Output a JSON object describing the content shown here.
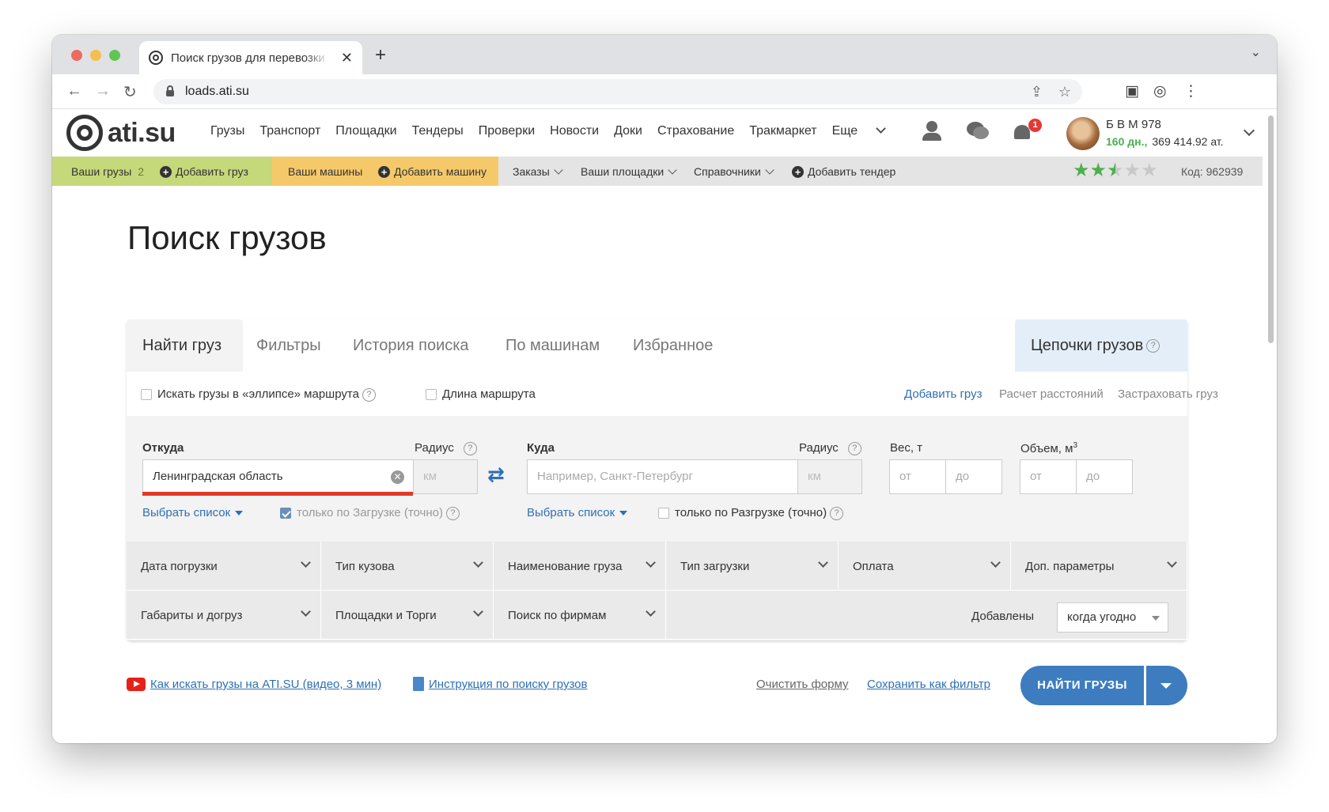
{
  "browser": {
    "tab_title": "Поиск грузов для перевозки",
    "tab_close": "✕",
    "new_tab": "+",
    "url": "loads.ati.su"
  },
  "header": {
    "logo_text": "ati.su",
    "nav": [
      "Грузы",
      "Транспорт",
      "Площадки",
      "Тендеры",
      "Проверки",
      "Новости",
      "Доки",
      "Страхование",
      "Тракмаркет"
    ],
    "more_label": "Еще",
    "notifications_count": "1",
    "user_name": "Б В М 978",
    "user_days": "160 дн.,",
    "user_balance": "369 414.92 ат."
  },
  "subbar": {
    "your_loads": "Ваши грузы",
    "your_loads_count": "2",
    "add_load": "Добавить груз",
    "your_trucks": "Ваши машины",
    "add_truck": "Добавить машину",
    "orders": "Заказы",
    "your_sites": "Ваши площадки",
    "references": "Справочники",
    "add_tender": "Добавить тендер",
    "rating": 2.5,
    "rating_max": 5,
    "code_label": "Код: 962939"
  },
  "main": {
    "title": "Поиск грузов",
    "tabs": [
      "Найти груз",
      "Фильтры",
      "История поиска",
      "По машинам",
      "Избранное"
    ],
    "chains_tab": "Цепочки грузов",
    "options": {
      "ellipse": "Искать грузы в «эллипсе» маршрута",
      "route_length": "Длина маршрута",
      "add_load": "Добавить груз",
      "distances": "Расчет расстояний",
      "insure": "Застраховать груз"
    },
    "from": {
      "label": "Откуда",
      "value": "Ленинградская область",
      "radius_label": "Радиус",
      "radius_placeholder": "км",
      "select_list": "Выбрать список",
      "only_loading": "только по Загрузке (точно)"
    },
    "to": {
      "label": "Куда",
      "placeholder": "Например, Санкт-Петербург",
      "radius_label": "Радиус",
      "radius_placeholder": "км",
      "select_list": "Выбрать список",
      "only_unloading": "только по Разгрузке (точно)"
    },
    "weight": {
      "label": "Вес, т",
      "from": "от",
      "to": "до"
    },
    "volume": {
      "label": "Объем, м",
      "sup": "3",
      "from": "от",
      "to": "до"
    },
    "filters_row1": [
      "Дата погрузки",
      "Тип кузова",
      "Наименование груза",
      "Тип загрузки",
      "Оплата",
      "Доп. параметры"
    ],
    "filters_row2": [
      "Габариты и догруз",
      "Площадки и Торги",
      "Поиск по фирмам"
    ],
    "added_label": "Добавлены",
    "added_value": "когда угодно",
    "video_link": "Как искать грузы на ATI.SU (видео, 3 мин)",
    "instruction_link": "Инструкция по поиску грузов",
    "clear_form": "Очистить форму",
    "save_filter": "Сохранить как фильтр",
    "find_button": "НАЙТИ ГРУЗЫ"
  },
  "colors": {
    "accent_blue": "#3d7dbf",
    "link_blue": "#2f6fb5",
    "green_segment": "#c5d87a",
    "orange_segment": "#f5c96a",
    "error_red": "#e23a2a",
    "star_green": "#4caf50"
  }
}
